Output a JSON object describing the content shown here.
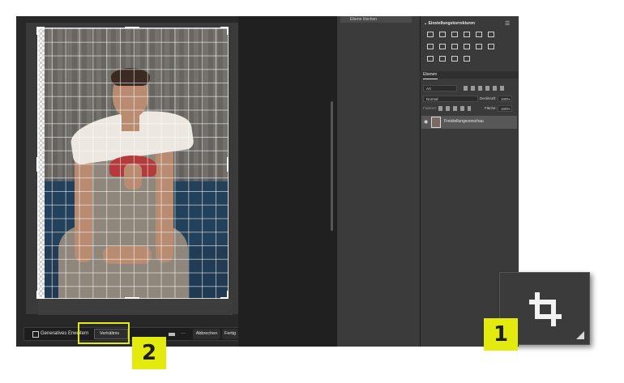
{
  "mid_panel": {
    "item_label": "Ebene löschen"
  },
  "adjustments": {
    "title": "Einstellungskorrekturen",
    "icons": [
      "brightness-icon",
      "levels-icon",
      "curves-icon",
      "exposure-icon",
      "vibrance-icon",
      "hue-saturation-icon",
      "color-balance-icon",
      "black-white-icon",
      "photo-filter-icon",
      "channel-mixer-icon",
      "color-lookup-icon",
      "invert-icon",
      "posterize-icon",
      "threshold-icon",
      "selective-color-icon",
      "gradient-map-icon"
    ]
  },
  "layers": {
    "tab_label": "Ebenen",
    "search_placeholder": "Art",
    "blend_mode": "Normal",
    "opacity_label": "Deckkraft:",
    "opacity_value": "100%",
    "lock_label": "Fixieren:",
    "fill_label": "Fläche:",
    "fill_value": "100%",
    "layer_name": "Freistellungsvorschau"
  },
  "context_bar": {
    "generative_label": "Generatives Erweitern",
    "ratio_label": "Verhältnis",
    "more_label": "···",
    "cancel_label": "Abbrechen",
    "done_label": "Fertig"
  },
  "callouts": {
    "one": "1",
    "two": "2"
  },
  "colors": {
    "callout": "#e3eb0e",
    "app_bg": "#2b2b2b",
    "panel_bg": "#3a3a3a"
  }
}
